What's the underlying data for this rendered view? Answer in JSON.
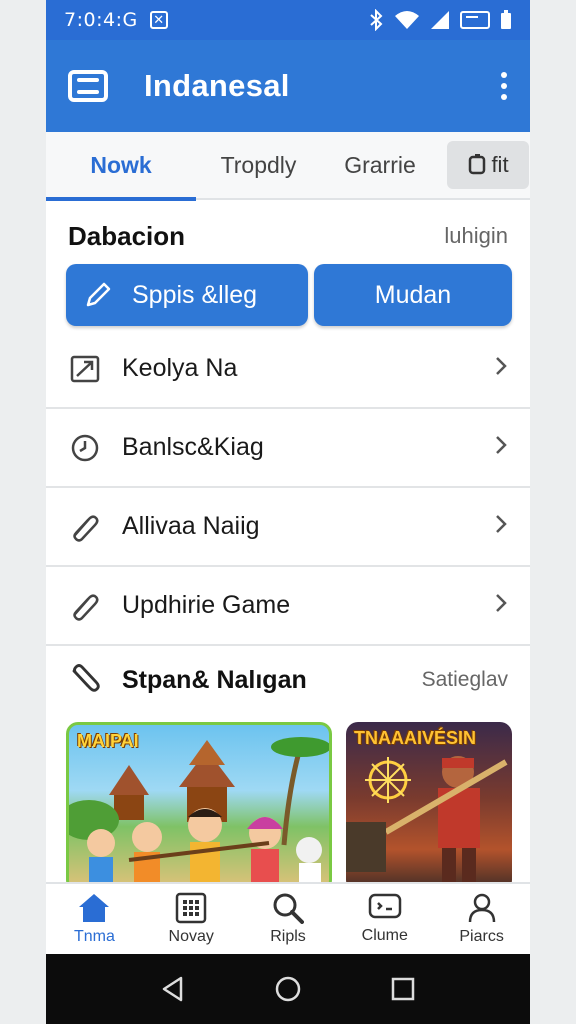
{
  "status_bar": {
    "time": "7:0:4:G"
  },
  "app_bar": {
    "title": "Indanesal"
  },
  "tabs": [
    {
      "label": "Nowk"
    },
    {
      "label": "Tropdly"
    },
    {
      "label": "Grarrie"
    },
    {
      "label": "fit"
    }
  ],
  "section": {
    "title": "Dabacion",
    "aux": "luhigin"
  },
  "actions": {
    "primary_label": "Sppis &lleg",
    "secondary_label": "Mudan"
  },
  "list_items": [
    {
      "label": "Keolya Na",
      "icon": "map-icon"
    },
    {
      "label": "Banlsc&Kiag",
      "icon": "clock-icon"
    },
    {
      "label": "Allivaa Naiig",
      "icon": "paperclip-icon"
    },
    {
      "label": "Updhirie Game",
      "icon": "paperclip-icon"
    }
  ],
  "featured": {
    "title": "Stpan& Nalıgan",
    "aux": "Satieglav"
  },
  "cards": [
    {
      "title": "MAIPAI"
    },
    {
      "title": "TNAAAIVÉSIN"
    }
  ],
  "bottom_nav": [
    {
      "label": "Tnma",
      "icon": "home-icon"
    },
    {
      "label": "Novay",
      "icon": "grid-icon"
    },
    {
      "label": "Ripls",
      "icon": "search-icon"
    },
    {
      "label": "Clume",
      "icon": "message-icon"
    },
    {
      "label": "Piarcs",
      "icon": "person-icon"
    }
  ],
  "colors": {
    "primary": "#2f78d6",
    "accent": "#2a6dd4",
    "active_nav": "#2a6dd4"
  }
}
